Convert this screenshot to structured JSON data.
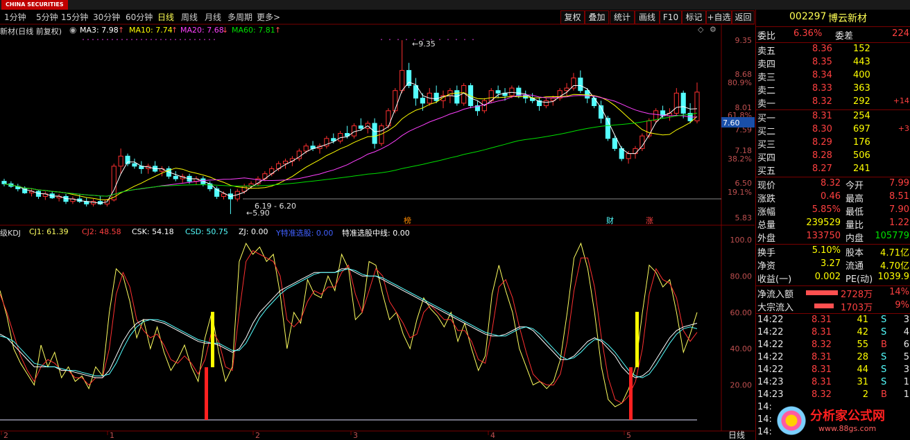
{
  "topbar": {
    "logo_text": "CHINA SECURITIES"
  },
  "timeframes": [
    "1分钟",
    "5分钟",
    "15分钟",
    "30分钟",
    "60分钟",
    "日线",
    "周线",
    "月线",
    "多周期",
    "更多>"
  ],
  "active_timeframe": "日线",
  "toolbar_buttons": [
    "复权",
    "叠加",
    "统计",
    "画线",
    "F10",
    "标记",
    "+自选",
    "返回"
  ],
  "ma_legend": {
    "name": "新材(日线 前复权)",
    "ma3": "MA3: 7.98",
    "ma10": "MA10: 7.74",
    "ma20": "MA20: 7.68",
    "ma60": "MA60: 7.81"
  },
  "kdj_legend": {
    "name": "级KDJ",
    "cj1": "CJ1: 61.39",
    "cj2": "CJ2: 48.58",
    "csk": "CSK: 54.18",
    "csd": "CSD: 50.75",
    "zj": "ZJ: 0.00",
    "line1": "Y特准选股: 0.00",
    "line2": "特准选股中线: 0.00"
  },
  "price_axis": [
    "9.35",
    "8.68",
    "80.9%",
    "8.01",
    "61.8%",
    "7.59",
    "7.18",
    "38.2%",
    "6.50",
    "19.1%",
    "5.83"
  ],
  "current_price_tag": "7.60",
  "chart_labels": {
    "high": "9.35",
    "low": "5.90",
    "low_range": "6.19 - 6.20",
    "markers": [
      "榜",
      "财",
      "涨"
    ]
  },
  "kdj_axis": [
    "100.0",
    "80.00",
    "60.00",
    "40.00",
    "20.00"
  ],
  "x_axis": [
    "2",
    "1",
    "2",
    "3",
    "4",
    "5"
  ],
  "bottom_tab": "日线",
  "quote": {
    "code": "002297",
    "name": "博云新材",
    "weibi_label": "委比",
    "weibi": "6.36%",
    "weicha_label": "委差",
    "weicha": "224",
    "asks": [
      {
        "label": "卖五",
        "price": "8.36",
        "vol": "152",
        "chg": ""
      },
      {
        "label": "卖四",
        "price": "8.35",
        "vol": "443",
        "chg": ""
      },
      {
        "label": "卖三",
        "price": "8.34",
        "vol": "400",
        "chg": ""
      },
      {
        "label": "卖二",
        "price": "8.33",
        "vol": "363",
        "chg": ""
      },
      {
        "label": "卖一",
        "price": "8.32",
        "vol": "292",
        "chg": "+14"
      }
    ],
    "bids": [
      {
        "label": "买一",
        "price": "8.31",
        "vol": "254",
        "chg": ""
      },
      {
        "label": "买二",
        "price": "8.30",
        "vol": "697",
        "chg": "+3"
      },
      {
        "label": "买三",
        "price": "8.29",
        "vol": "176",
        "chg": ""
      },
      {
        "label": "买四",
        "price": "8.28",
        "vol": "506",
        "chg": ""
      },
      {
        "label": "买五",
        "price": "8.27",
        "vol": "241",
        "chg": ""
      }
    ],
    "stats": [
      {
        "l1": "现价",
        "v1": "8.32",
        "l2": "今开",
        "v2": "7.99"
      },
      {
        "l1": "涨跌",
        "v1": "0.46",
        "l2": "最高",
        "v2": "8.51"
      },
      {
        "l1": "涨幅",
        "v1": "5.85%",
        "l2": "最低",
        "v2": "7.90"
      },
      {
        "l1": "总量",
        "v1": "239529",
        "l2": "量比",
        "v2": "1.22"
      },
      {
        "l1": "外盘",
        "v1": "133750",
        "l2": "内盘",
        "v2": "105779"
      }
    ],
    "stats2": [
      {
        "l1": "换手",
        "v1": "5.10%",
        "l2": "股本",
        "v2": "4.71亿"
      },
      {
        "l1": "净资",
        "v1": "3.27",
        "l2": "流通",
        "v2": "4.70亿"
      },
      {
        "l1": "收益(一)",
        "v1": "0.002",
        "l2": "PE(动)",
        "v2": "1039.9"
      }
    ],
    "flows": [
      {
        "label": "净流入额",
        "value": "2728万",
        "pct": "14%"
      },
      {
        "label": "大宗流入",
        "value": "1703万",
        "pct": "9%"
      }
    ],
    "ticks": [
      {
        "t": "14:22",
        "p": "8.31",
        "v": "41",
        "s": "S",
        "n": "3"
      },
      {
        "t": "14:22",
        "p": "8.31",
        "v": "42",
        "s": "S",
        "n": "4"
      },
      {
        "t": "14:22",
        "p": "8.32",
        "v": "55",
        "s": "B",
        "n": "6"
      },
      {
        "t": "14:22",
        "p": "8.31",
        "v": "28",
        "s": "S",
        "n": "5"
      },
      {
        "t": "14:22",
        "p": "8.31",
        "v": "44",
        "s": "S",
        "n": "3"
      },
      {
        "t": "14:23",
        "p": "8.31",
        "v": "31",
        "s": "S",
        "n": "1"
      },
      {
        "t": "14:23",
        "p": "8.32",
        "v": "2",
        "s": "B",
        "n": "1"
      },
      {
        "t": "14:",
        "p": "",
        "v": "",
        "s": "",
        "n": ""
      },
      {
        "t": "14:",
        "p": "",
        "v": "",
        "s": "",
        "n": ""
      },
      {
        "t": "14:",
        "p": "",
        "v": "",
        "s": "",
        "n": ""
      }
    ],
    "watermark": "分析家公式网",
    "watermark_url": "www.88gs.com"
  },
  "colors": {
    "up": "#ff3030",
    "down": "#54ffff",
    "ma3": "#ffffff",
    "ma10": "#ffff00",
    "ma20": "#ff40ff",
    "ma60": "#00e000"
  },
  "chart_data": {
    "type": "candlestick",
    "price_axis_ticks": [
      9.35,
      8.68,
      8.01,
      7.59,
      7.18,
      6.5,
      5.83
    ],
    "ohlc": [
      [
        6.55,
        6.6,
        6.45,
        6.5
      ],
      [
        6.5,
        6.55,
        6.42,
        6.45
      ],
      [
        6.45,
        6.5,
        6.35,
        6.4
      ],
      [
        6.4,
        6.45,
        6.3,
        6.32
      ],
      [
        6.32,
        6.4,
        6.25,
        6.35
      ],
      [
        6.35,
        6.38,
        6.2,
        6.25
      ],
      [
        6.25,
        6.35,
        6.18,
        6.3
      ],
      [
        6.3,
        6.35,
        6.2,
        6.22
      ],
      [
        6.22,
        6.3,
        6.15,
        6.25
      ],
      [
        6.25,
        6.3,
        6.1,
        6.15
      ],
      [
        6.15,
        6.25,
        6.1,
        6.2
      ],
      [
        6.2,
        6.28,
        6.12,
        6.15
      ],
      [
        6.15,
        6.22,
        6.05,
        6.1
      ],
      [
        6.1,
        6.2,
        6.05,
        6.15
      ],
      [
        6.15,
        6.25,
        6.08,
        6.1
      ],
      [
        6.1,
        6.2,
        6.05,
        6.18
      ],
      [
        6.18,
        6.9,
        6.15,
        6.85
      ],
      [
        6.85,
        7.2,
        6.7,
        7.05
      ],
      [
        7.05,
        7.1,
        6.85,
        6.9
      ],
      [
        6.9,
        7.0,
        6.8,
        6.85
      ],
      [
        6.85,
        6.95,
        6.7,
        6.8
      ],
      [
        6.8,
        6.9,
        6.7,
        6.85
      ],
      [
        6.85,
        6.95,
        6.72,
        6.75
      ],
      [
        6.75,
        6.85,
        6.65,
        6.8
      ],
      [
        6.8,
        6.85,
        6.6,
        6.65
      ],
      [
        6.65,
        6.75,
        6.55,
        6.6
      ],
      [
        6.6,
        6.7,
        6.52,
        6.65
      ],
      [
        6.65,
        6.7,
        6.5,
        6.55
      ],
      [
        6.55,
        6.65,
        6.48,
        6.6
      ],
      [
        6.6,
        6.65,
        6.45,
        6.5
      ],
      [
        6.5,
        6.55,
        6.35,
        6.4
      ],
      [
        6.4,
        6.45,
        6.2,
        6.25
      ],
      [
        6.25,
        6.35,
        6.19,
        6.3
      ],
      [
        6.3,
        6.4,
        5.9,
        6.2
      ],
      [
        6.2,
        6.4,
        6.15,
        6.35
      ],
      [
        6.35,
        6.5,
        6.3,
        6.45
      ],
      [
        6.45,
        6.55,
        6.4,
        6.5
      ],
      [
        6.5,
        6.65,
        6.45,
        6.6
      ],
      [
        6.6,
        6.75,
        6.55,
        6.7
      ],
      [
        6.7,
        6.85,
        6.65,
        6.8
      ],
      [
        6.8,
        6.95,
        6.75,
        6.9
      ],
      [
        6.9,
        7.0,
        6.8,
        6.95
      ],
      [
        6.95,
        7.05,
        6.85,
        7.0
      ],
      [
        7.0,
        7.2,
        6.95,
        7.15
      ],
      [
        7.15,
        7.3,
        7.1,
        7.25
      ],
      [
        7.25,
        7.35,
        7.15,
        7.2
      ],
      [
        7.2,
        7.3,
        7.1,
        7.25
      ],
      [
        7.25,
        7.45,
        7.2,
        7.4
      ],
      [
        7.4,
        7.5,
        7.3,
        7.35
      ],
      [
        7.35,
        7.55,
        7.3,
        7.5
      ],
      [
        7.5,
        7.65,
        7.4,
        7.45
      ],
      [
        7.45,
        7.7,
        7.4,
        7.65
      ],
      [
        7.65,
        7.8,
        7.55,
        7.6
      ],
      [
        7.6,
        7.75,
        7.5,
        7.7
      ],
      [
        7.7,
        7.8,
        7.2,
        7.3
      ],
      [
        7.3,
        7.7,
        7.25,
        7.65
      ],
      [
        7.65,
        8.0,
        7.6,
        7.95
      ],
      [
        7.95,
        8.4,
        7.9,
        8.35
      ],
      [
        8.35,
        9.35,
        8.3,
        8.75
      ],
      [
        8.75,
        8.9,
        8.4,
        8.45
      ],
      [
        8.45,
        8.6,
        8.05,
        8.2
      ],
      [
        8.2,
        8.3,
        7.95,
        8.1
      ],
      [
        8.1,
        8.4,
        8.05,
        8.3
      ],
      [
        8.3,
        8.45,
        8.1,
        8.15
      ],
      [
        8.15,
        8.35,
        8.0,
        8.25
      ],
      [
        8.25,
        8.4,
        8.1,
        8.35
      ],
      [
        8.35,
        8.45,
        8.05,
        8.1
      ],
      [
        8.1,
        8.5,
        8.05,
        8.45
      ],
      [
        8.45,
        8.5,
        8.0,
        8.05
      ],
      [
        8.05,
        8.15,
        7.85,
        7.95
      ],
      [
        7.95,
        8.2,
        7.9,
        8.15
      ],
      [
        8.15,
        8.4,
        8.1,
        8.35
      ],
      [
        8.35,
        8.45,
        8.2,
        8.3
      ],
      [
        8.3,
        8.4,
        8.15,
        8.25
      ],
      [
        8.25,
        8.45,
        8.2,
        8.4
      ],
      [
        8.4,
        8.45,
        8.2,
        8.25
      ],
      [
        8.25,
        8.35,
        8.1,
        8.2
      ],
      [
        8.2,
        8.3,
        8.1,
        8.15
      ],
      [
        8.15,
        8.2,
        7.95,
        8.05
      ],
      [
        8.05,
        8.2,
        8.0,
        8.15
      ],
      [
        8.15,
        8.25,
        8.05,
        8.2
      ],
      [
        8.2,
        8.4,
        8.15,
        8.35
      ],
      [
        8.35,
        8.5,
        8.25,
        8.4
      ],
      [
        8.4,
        8.7,
        8.35,
        8.6
      ],
      [
        8.6,
        8.75,
        8.3,
        8.35
      ],
      [
        8.35,
        8.4,
        8.1,
        8.2
      ],
      [
        8.2,
        8.25,
        8.0,
        8.05
      ],
      [
        8.05,
        8.15,
        7.7,
        7.8
      ],
      [
        7.8,
        7.85,
        7.35,
        7.4
      ],
      [
        7.4,
        7.45,
        7.15,
        7.2
      ],
      [
        7.2,
        7.25,
        6.95,
        7.0
      ],
      [
        7.0,
        7.15,
        6.9,
        7.1
      ],
      [
        7.1,
        7.25,
        7.0,
        7.2
      ],
      [
        7.2,
        7.5,
        7.15,
        7.45
      ],
      [
        7.45,
        7.8,
        7.4,
        7.75
      ],
      [
        7.75,
        8.0,
        7.7,
        7.95
      ],
      [
        7.95,
        8.05,
        7.8,
        7.85
      ],
      [
        7.85,
        8.0,
        7.75,
        7.9
      ],
      [
        7.9,
        8.4,
        7.85,
        8.3
      ],
      [
        8.3,
        8.35,
        7.8,
        7.9
      ],
      [
        7.9,
        8.1,
        7.7,
        7.75
      ],
      [
        7.75,
        8.51,
        7.7,
        8.32
      ]
    ],
    "kdj": {
      "cj1": [
        72,
        58,
        40,
        32,
        26,
        20,
        42,
        30,
        38,
        24,
        30,
        22,
        25,
        18,
        30,
        25,
        60,
        84,
        80,
        66,
        46,
        56,
        40,
        52,
        38,
        28,
        34,
        42,
        30,
        22,
        46,
        60,
        38,
        22,
        30,
        88,
        98,
        92,
        96,
        88,
        92,
        70,
        40,
        60,
        54,
        78,
        70,
        68,
        80,
        72,
        92,
        84,
        56,
        60,
        88,
        86,
        70,
        56,
        60,
        48,
        40,
        56,
        68,
        62,
        58,
        52,
        60,
        44,
        54,
        40,
        28,
        36,
        70,
        86,
        72,
        60,
        40,
        30,
        20,
        22,
        18,
        22,
        34,
        60,
        90,
        98,
        84,
        60,
        30,
        12,
        8,
        10,
        18,
        30,
        60,
        86,
        82,
        74,
        78,
        60,
        38,
        48,
        60
      ],
      "cj2": [
        70,
        60,
        48,
        36,
        28,
        22,
        30,
        34,
        32,
        28,
        28,
        24,
        24,
        20,
        24,
        24,
        40,
        70,
        82,
        74,
        56,
        50,
        46,
        48,
        42,
        34,
        32,
        36,
        32,
        26,
        34,
        50,
        44,
        30,
        28,
        60,
        88,
        94,
        92,
        90,
        88,
        80,
        56,
        52,
        56,
        66,
        72,
        70,
        74,
        74,
        82,
        86,
        70,
        60,
        72,
        84,
        80,
        66,
        60,
        54,
        46,
        48,
        60,
        64,
        60,
        56,
        56,
        50,
        50,
        44,
        34,
        32,
        50,
        74,
        78,
        68,
        52,
        38,
        26,
        22,
        20,
        20,
        26,
        44,
        72,
        90,
        90,
        74,
        46,
        24,
        12,
        10,
        14,
        22,
        40,
        70,
        84,
        78,
        76,
        68,
        50,
        44,
        49
      ],
      "csk": [
        48,
        46,
        42,
        38,
        34,
        30,
        30,
        30,
        30,
        28,
        28,
        27,
        26,
        25,
        24,
        24,
        28,
        36,
        44,
        50,
        54,
        56,
        56,
        55,
        54,
        52,
        50,
        48,
        46,
        44,
        43,
        43,
        42,
        40,
        38,
        40,
        46,
        54,
        60,
        64,
        68,
        72,
        74,
        76,
        78,
        80,
        82,
        82,
        82,
        82,
        84,
        84,
        82,
        80,
        80,
        80,
        78,
        76,
        74,
        72,
        70,
        68,
        66,
        64,
        62,
        60,
        58,
        56,
        54,
        52,
        50,
        48,
        47,
        47,
        48,
        50,
        52,
        52,
        50,
        46,
        42,
        38,
        34,
        34,
        36,
        40,
        44,
        46,
        44,
        40,
        36,
        30,
        26,
        24,
        25,
        28,
        34,
        40,
        46,
        50,
        52,
        53,
        54
      ],
      "csd": [
        47,
        46,
        44,
        40,
        36,
        32,
        31,
        30,
        30,
        29,
        28,
        28,
        27,
        26,
        25,
        25,
        26,
        32,
        40,
        47,
        52,
        55,
        56,
        56,
        55,
        53,
        51,
        49,
        47,
        45,
        44,
        43,
        43,
        41,
        39,
        39,
        43,
        50,
        57,
        62,
        66,
        70,
        73,
        75,
        77,
        79,
        81,
        82,
        82,
        82,
        83,
        84,
        83,
        81,
        80,
        80,
        79,
        77,
        75,
        73,
        71,
        69,
        67,
        65,
        63,
        61,
        59,
        57,
        55,
        53,
        51,
        49,
        48,
        47,
        47,
        49,
        51,
        52,
        51,
        48,
        44,
        40,
        36,
        34,
        35,
        38,
        42,
        45,
        45,
        42,
        38,
        33,
        28,
        25,
        24,
        26,
        31,
        37,
        43,
        48,
        51,
        52,
        51
      ]
    },
    "kdj_axis_ticks": [
      100,
      80,
      60,
      40,
      20
    ]
  }
}
